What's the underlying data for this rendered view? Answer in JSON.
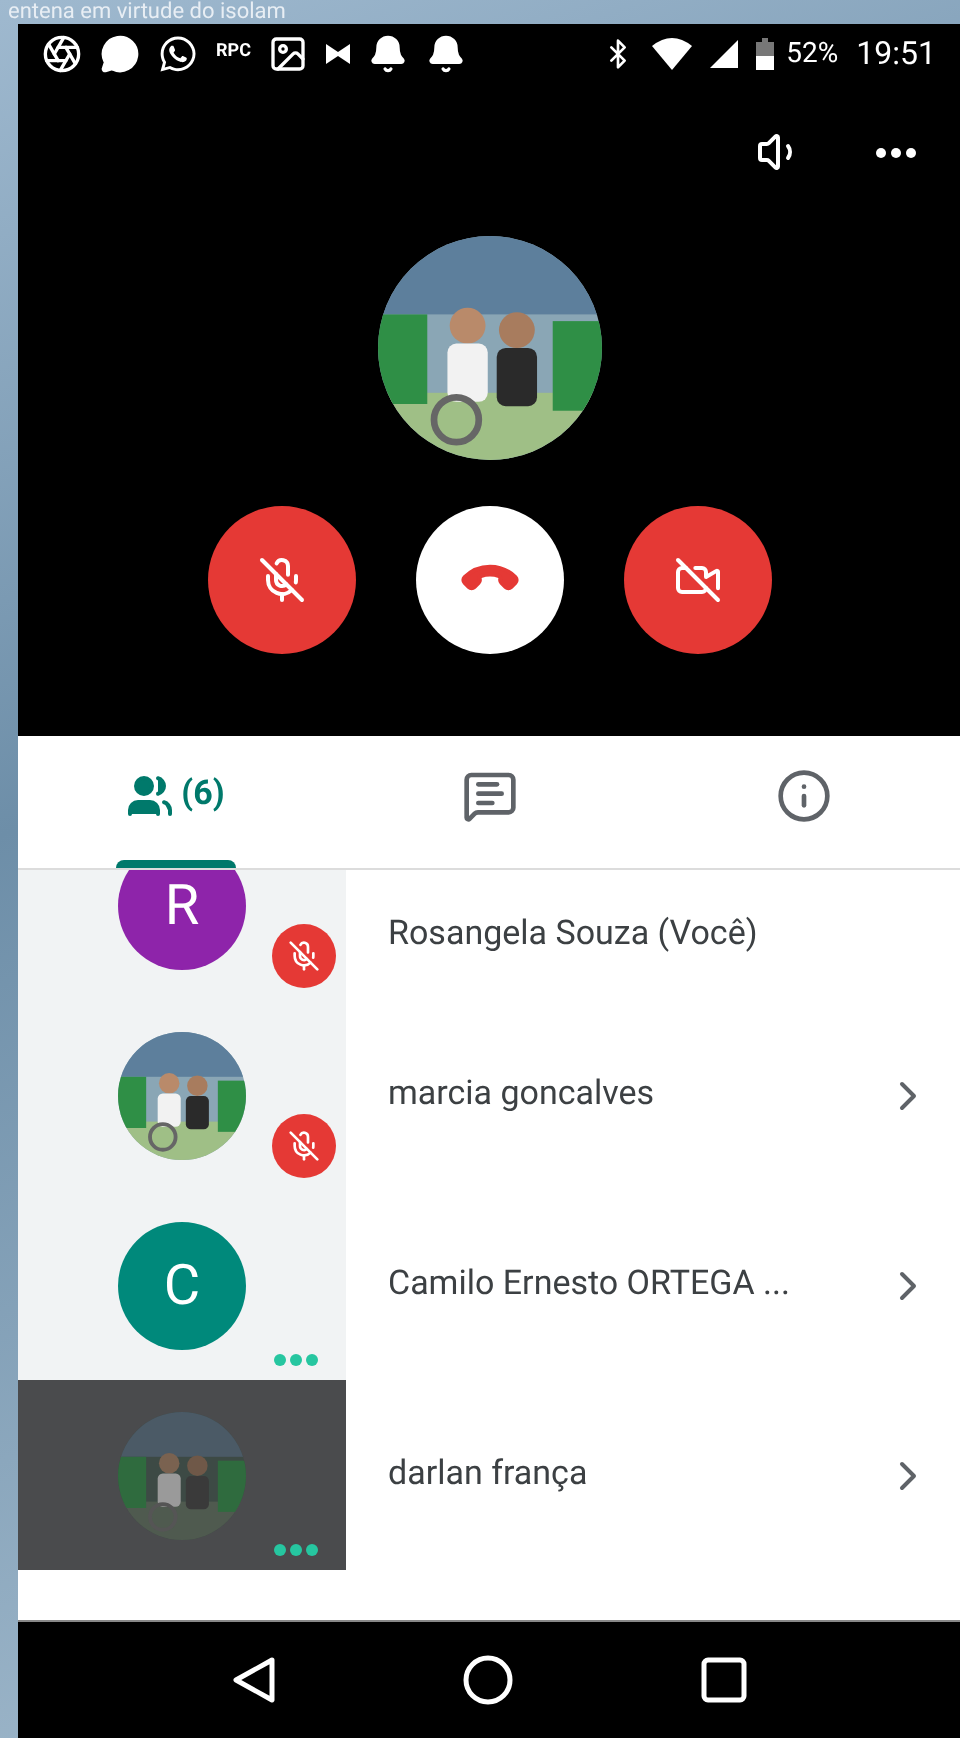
{
  "background_caption": "entena em virtude do isolam",
  "status_bar": {
    "rpc_label": "RPC",
    "battery": "52%",
    "time": "19:51"
  },
  "call": {
    "buttons": [
      {
        "kind": "mic_off"
      },
      {
        "kind": "end_call"
      },
      {
        "kind": "camera_off"
      }
    ]
  },
  "tabs": [
    {
      "kind": "people",
      "label": "(6)",
      "selected": true
    },
    {
      "kind": "chat",
      "selected": false
    },
    {
      "kind": "info",
      "selected": false
    }
  ],
  "participants": [
    {
      "name": "Rosangela Souza (Você)",
      "avatar": {
        "kind": "letter",
        "letter": "R",
        "color": "#8e24aa"
      },
      "badge": {
        "kind": "muted"
      },
      "chevron": false,
      "highlighted": false
    },
    {
      "name": "marcia goncalves",
      "badge": {
        "kind": "muted"
      },
      "chevron": true,
      "highlighted": false
    },
    {
      "name": "Camilo Ernesto ORTEGA ...",
      "avatar": {
        "kind": "letter",
        "letter": "C",
        "color": "#00897b"
      },
      "badge": {
        "kind": "connecting"
      },
      "chevron": true,
      "highlighted": false
    },
    {
      "name": "darlan frança",
      "badge": {
        "kind": "connecting"
      },
      "chevron": true,
      "highlighted": true
    }
  ]
}
